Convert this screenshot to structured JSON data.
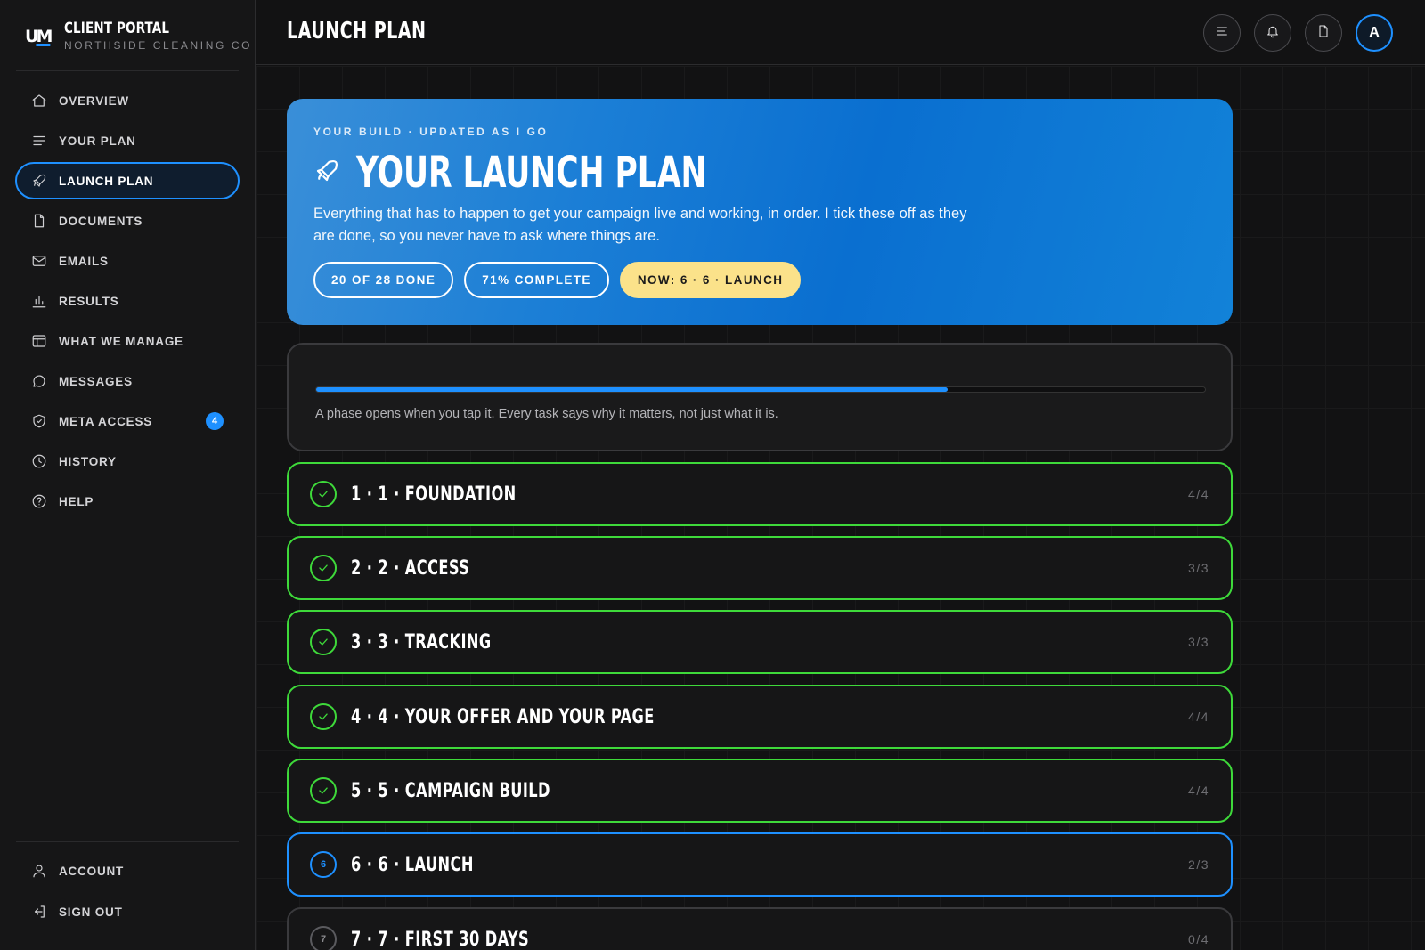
{
  "brand": {
    "logo_text_u": "U",
    "logo_text_m": "M",
    "title": "CLIENT PORTAL",
    "subtitle": "NORTHSIDE CLEANING CO"
  },
  "sidebar": {
    "items": [
      {
        "label": "OVERVIEW",
        "icon": "home-icon"
      },
      {
        "label": "YOUR PLAN",
        "icon": "list-icon"
      },
      {
        "label": "LAUNCH PLAN",
        "icon": "rocket-icon",
        "active": true
      },
      {
        "label": "DOCUMENTS",
        "icon": "document-icon"
      },
      {
        "label": "EMAILS",
        "icon": "mail-icon"
      },
      {
        "label": "RESULTS",
        "icon": "bar-chart-icon"
      },
      {
        "label": "WHAT WE MANAGE",
        "icon": "layout-icon"
      },
      {
        "label": "MESSAGES",
        "icon": "chat-icon"
      },
      {
        "label": "META ACCESS",
        "icon": "shield-icon",
        "badge": "4"
      },
      {
        "label": "HISTORY",
        "icon": "clock-icon"
      },
      {
        "label": "HELP",
        "icon": "help-icon"
      }
    ],
    "bottom": [
      {
        "label": "ACCOUNT",
        "icon": "user-icon"
      },
      {
        "label": "SIGN OUT",
        "icon": "sign-out-icon"
      }
    ]
  },
  "header": {
    "title": "LAUNCH PLAN",
    "avatar_initial": "A"
  },
  "hero": {
    "kicker": "YOUR BUILD · UPDATED AS I GO",
    "title": "YOUR LAUNCH PLAN",
    "description": "Everything that has to happen to get your campaign live and working, in order. I tick these off as they are done, so you never have to ask where things are.",
    "pills": {
      "done": "20 OF 28 DONE",
      "percent": "71% COMPLETE",
      "now": "NOW: 6 · 6 · LAUNCH"
    }
  },
  "progress": {
    "fraction": 0.71,
    "note": "A phase opens when you tap it. Every task says why it matters, not just what it is."
  },
  "phases": [
    {
      "title": "1 · 1 · FOUNDATION",
      "count": "4/4",
      "status": "done"
    },
    {
      "title": "2 · 2 · ACCESS",
      "count": "3/3",
      "status": "done"
    },
    {
      "title": "3 · 3 · TRACKING",
      "count": "3/3",
      "status": "done"
    },
    {
      "title": "4 · 4 · YOUR OFFER AND YOUR PAGE",
      "count": "4/4",
      "status": "done"
    },
    {
      "title": "5 · 5 · CAMPAIGN BUILD",
      "count": "4/4",
      "status": "done"
    },
    {
      "title": "6 · 6 · LAUNCH",
      "count": "2/3",
      "status": "current",
      "marker": "6"
    },
    {
      "title": "7 · 7 · FIRST 30 DAYS",
      "count": "0/4",
      "status": "pending",
      "marker": "7"
    }
  ],
  "colors": {
    "accent": "#1e90ff",
    "done": "#3ed93a",
    "now_pill": "#fbe28a"
  }
}
